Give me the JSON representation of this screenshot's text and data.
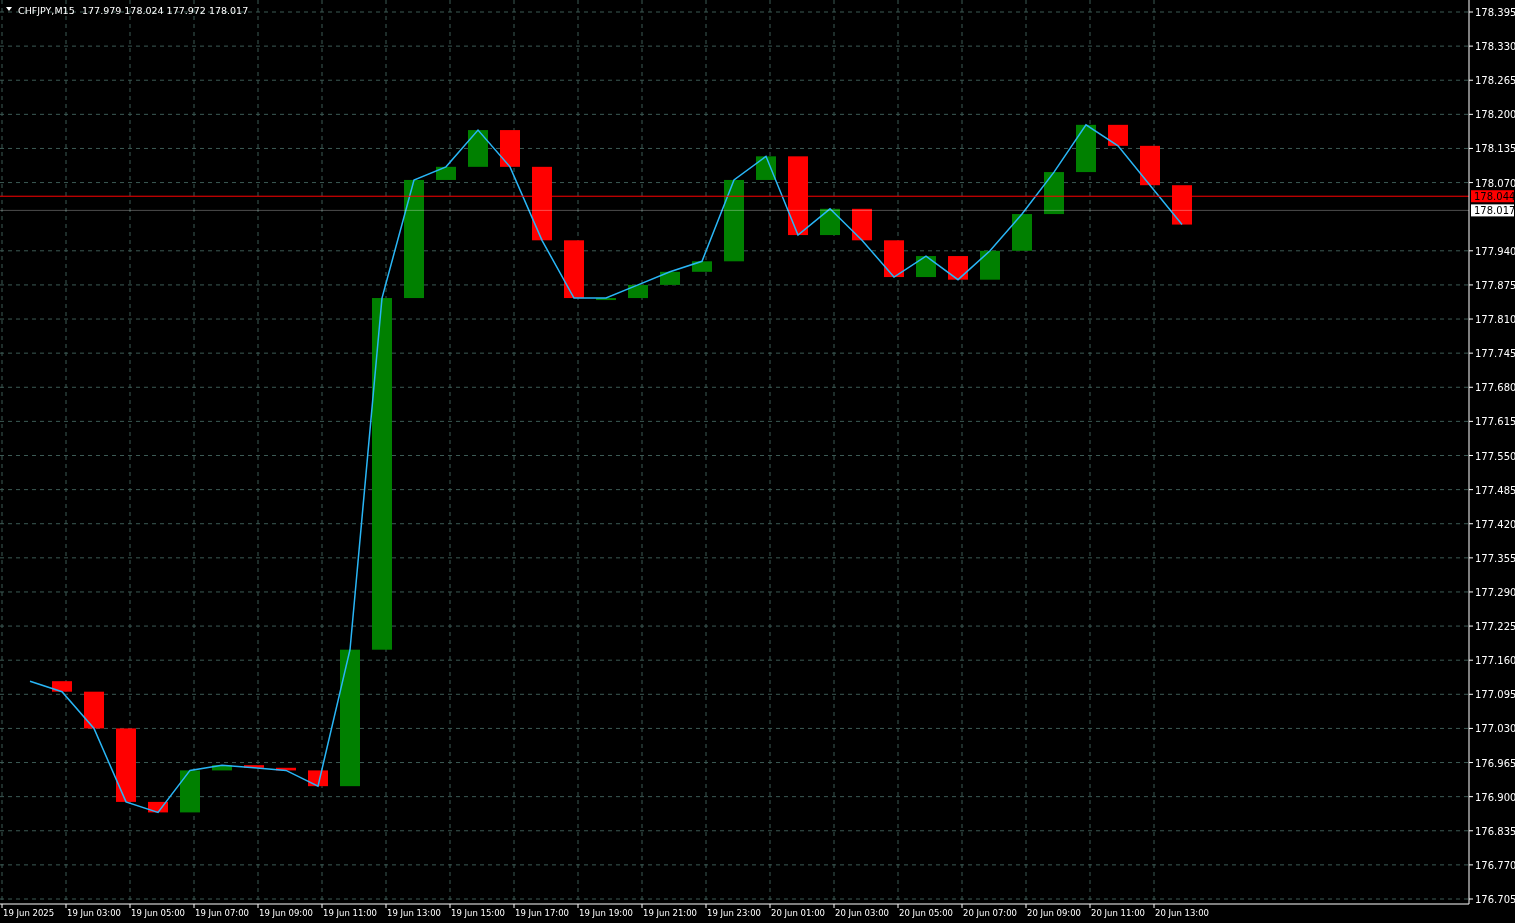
{
  "header": {
    "symbol": "CHFJPY,M15",
    "ohlc": "177.979 178.024 177.972 178.017"
  },
  "chart_data": {
    "type": "line",
    "grid": true,
    "ylim": [
      176.705,
      178.395
    ],
    "categories": [
      "19 Jun 2025",
      null,
      "19 Jun 03:00",
      null,
      "19 Jun 05:00",
      null,
      "19 Jun 07:00",
      null,
      "19 Jun 09:00",
      null,
      "19 Jun 11:00",
      null,
      "19 Jun 13:00",
      null,
      "19 Jun 15:00",
      null,
      "19 Jun 17:00",
      null,
      "19 Jun 19:00",
      null,
      "19 Jun 21:00",
      null,
      "19 Jun 23:00",
      null,
      "20 Jun 01:00",
      null,
      "20 Jun 03:00",
      null,
      "20 Jun 05:00",
      null,
      "20 Jun 07:00",
      null,
      "20 Jun 09:00",
      null,
      "20 Jun 11:00",
      null,
      "20 Jun 13:00"
    ],
    "series": [
      {
        "color": "#29b6f6",
        "values": [
          177.12,
          177.1,
          177.03,
          176.89,
          176.87,
          176.95,
          176.96,
          176.955,
          176.95,
          176.92,
          177.18,
          177.85,
          178.075,
          178.1,
          178.17,
          178.1,
          177.96,
          177.85,
          177.85,
          177.875,
          177.9,
          177.92,
          178.075,
          178.12,
          177.97,
          178.02,
          177.96,
          177.89,
          177.93,
          177.885,
          177.94,
          178.01,
          178.09,
          178.18,
          178.14,
          178.065,
          177.99
        ]
      }
    ],
    "yticks": [
      {
        "value": 178.395,
        "label": "178.395"
      },
      {
        "value": 178.33,
        "label": "178.330"
      },
      {
        "value": 178.265,
        "label": "178.265"
      },
      {
        "value": 178.2,
        "label": "178.200"
      },
      {
        "value": 178.135,
        "label": "178.135"
      },
      {
        "value": 178.07,
        "label": "178.070"
      },
      {
        "value": 177.94,
        "label": "177.940"
      },
      {
        "value": 177.875,
        "label": "177.875"
      },
      {
        "value": 177.81,
        "label": "177.810"
      },
      {
        "value": 177.745,
        "label": "177.745"
      },
      {
        "value": 177.68,
        "label": "177.680"
      },
      {
        "value": 177.615,
        "label": "177.615"
      },
      {
        "value": 177.55,
        "label": "177.550"
      },
      {
        "value": 177.485,
        "label": "177.485"
      },
      {
        "value": 177.42,
        "label": "177.420"
      },
      {
        "value": 177.355,
        "label": "177.355"
      },
      {
        "value": 177.29,
        "label": "177.290"
      },
      {
        "value": 177.225,
        "label": "177.225"
      },
      {
        "value": 177.16,
        "label": "177.160"
      },
      {
        "value": 177.095,
        "label": "177.095"
      },
      {
        "value": 177.03,
        "label": "177.030"
      },
      {
        "value": 176.965,
        "label": "176.965"
      },
      {
        "value": 176.9,
        "label": "176.900"
      },
      {
        "value": 176.835,
        "label": "176.835"
      },
      {
        "value": 176.77,
        "label": "176.770"
      },
      {
        "value": 176.705,
        "label": "176.705"
      }
    ],
    "ref_lines": [
      {
        "axis": "y",
        "value": 178.044,
        "label": "178.044",
        "color": "#ff0000"
      },
      {
        "axis": "y",
        "value": 178.017,
        "label": "178.017",
        "color": "#ffffff"
      }
    ]
  }
}
